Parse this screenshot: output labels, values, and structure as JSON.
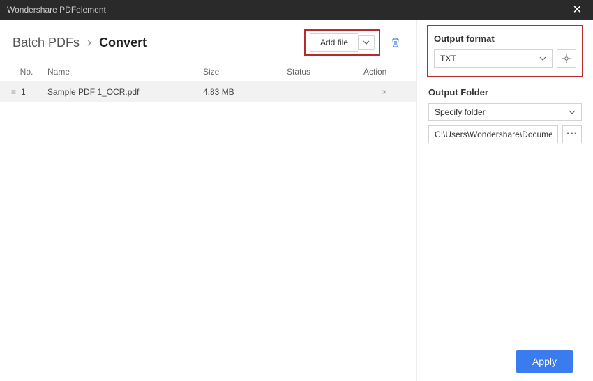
{
  "window": {
    "title": "Wondershare PDFelement"
  },
  "breadcrumb": {
    "root": "Batch PDFs",
    "current": "Convert"
  },
  "toolbar": {
    "add_file_label": "Add file"
  },
  "columns": {
    "no": "No.",
    "name": "Name",
    "size": "Size",
    "status": "Status",
    "action": "Action"
  },
  "rows": [
    {
      "no": "1",
      "name": "Sample PDF 1_OCR.pdf",
      "size": "4.83 MB",
      "status": "",
      "action": "×"
    }
  ],
  "output_format": {
    "label": "Output format",
    "value": "TXT"
  },
  "output_folder": {
    "label": "Output Folder",
    "mode": "Specify folder",
    "path": "C:\\Users\\Wondershare\\Documents"
  },
  "footer": {
    "apply_label": "Apply"
  }
}
